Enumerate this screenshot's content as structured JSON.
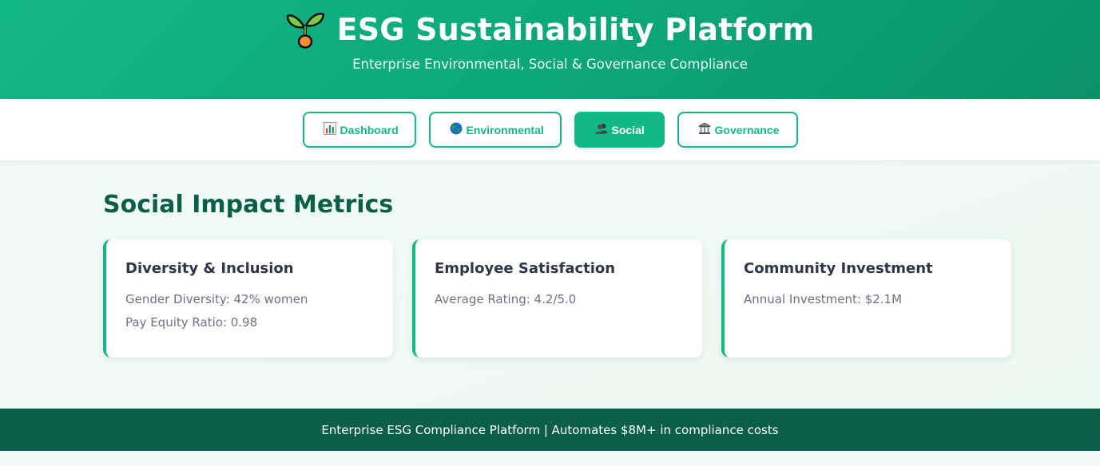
{
  "header": {
    "logo_icon": "seedling-icon",
    "title": "ESG Sustainability Platform",
    "subtitle": "Enterprise Environmental, Social & Governance Compliance"
  },
  "nav": {
    "active": "social",
    "buttons": [
      {
        "id": "dashboard",
        "icon": "bar-chart-icon",
        "label": "Dashboard"
      },
      {
        "id": "environmental",
        "icon": "globe-icon",
        "label": "Environmental"
      },
      {
        "id": "social",
        "icon": "people-icon",
        "label": "Social"
      },
      {
        "id": "governance",
        "icon": "classical-building-icon",
        "label": "Governance"
      }
    ]
  },
  "main": {
    "section_title": "Social Impact Metrics",
    "cards": [
      {
        "title": "Diversity & Inclusion",
        "lines": [
          "Gender Diversity: 42% women",
          "Pay Equity Ratio: 0.98"
        ]
      },
      {
        "title": "Employee Satisfaction",
        "lines": [
          "Average Rating: 4.2/5.0"
        ]
      },
      {
        "title": "Community Investment",
        "lines": [
          "Annual Investment: $2.1M"
        ]
      }
    ]
  },
  "footer": {
    "text": "Enterprise ESG Compliance Platform | Automates $8M+ in compliance costs"
  },
  "colors": {
    "accent": "#12b886",
    "header_dark": "#099268",
    "footer": "#0b5e47",
    "section_title": "#0b5e47",
    "page_bg": "#f0fbf5"
  }
}
